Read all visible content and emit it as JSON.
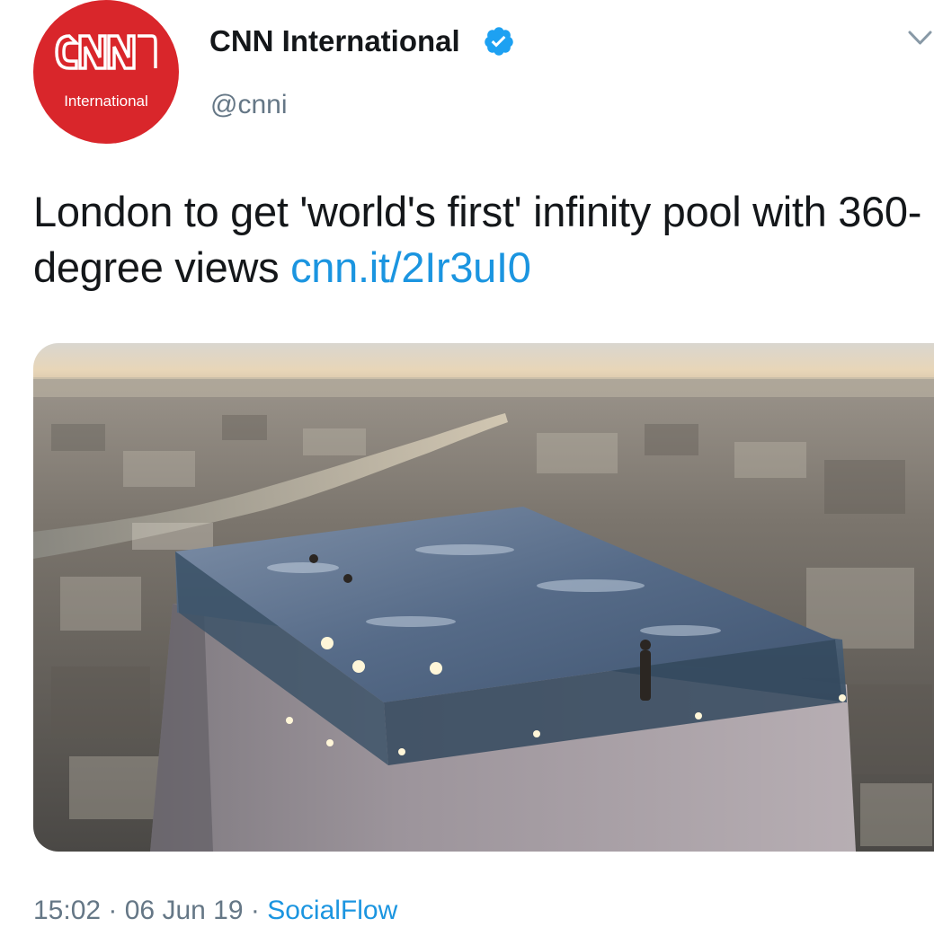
{
  "account": {
    "display_name": "CNN International",
    "handle": "@cnni",
    "avatar_logo_text": "CNN",
    "avatar_logo_sub": "International",
    "verified": true
  },
  "tweet": {
    "text": "London to get 'world's first' infinity pool with 360-degree views ",
    "link": "cnn.it/2Ir3uI0"
  },
  "meta": {
    "time": "15:02",
    "separator_1": " · ",
    "date": "06 Jun 19",
    "separator_2": " · ",
    "source": "SocialFlow"
  },
  "icons": {
    "verified": "verified-badge-icon",
    "menu": "chevron-down-icon"
  },
  "colors": {
    "link": "#1b95e0",
    "secondary_text": "#657786",
    "primary_text": "#14171a",
    "avatar_bg": "#d9262b"
  }
}
